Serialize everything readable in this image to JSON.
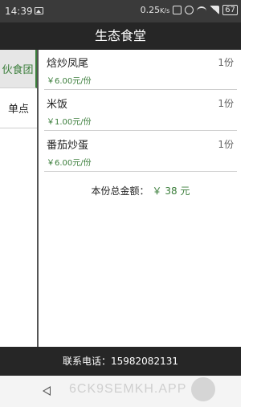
{
  "status_bar": {
    "time": "14:39",
    "speed": "0.25",
    "speed_unit": "K/s",
    "battery": "67",
    "icons": [
      "image-icon",
      "vibrate-icon",
      "alarm-icon",
      "wifi-icon",
      "signal-icon",
      "battery-icon"
    ]
  },
  "header": {
    "title": "生态食堂"
  },
  "sidebar": {
    "items": [
      {
        "label": "伙食团",
        "active": true
      },
      {
        "label": "单点",
        "active": false
      }
    ]
  },
  "dishes": [
    {
      "name": "焓炒凤尾",
      "quantity": "1份",
      "price": "￥6.00元/份"
    },
    {
      "name": "米饭",
      "quantity": "1份",
      "price": "￥1.00元/份"
    },
    {
      "name": "番茄炒蛋",
      "quantity": "1份",
      "price": "￥6.00元/份"
    }
  ],
  "total": {
    "label": "本份总金额：",
    "amount": "￥ 38 元"
  },
  "footer": {
    "contact": "联系电话：15982082131"
  },
  "nav": {
    "watermark": "6CK9SEMKH.APP"
  },
  "colors": {
    "accent": "#3a7d3a",
    "header_bg": "#262626",
    "status_bg": "#3a3a3a"
  }
}
